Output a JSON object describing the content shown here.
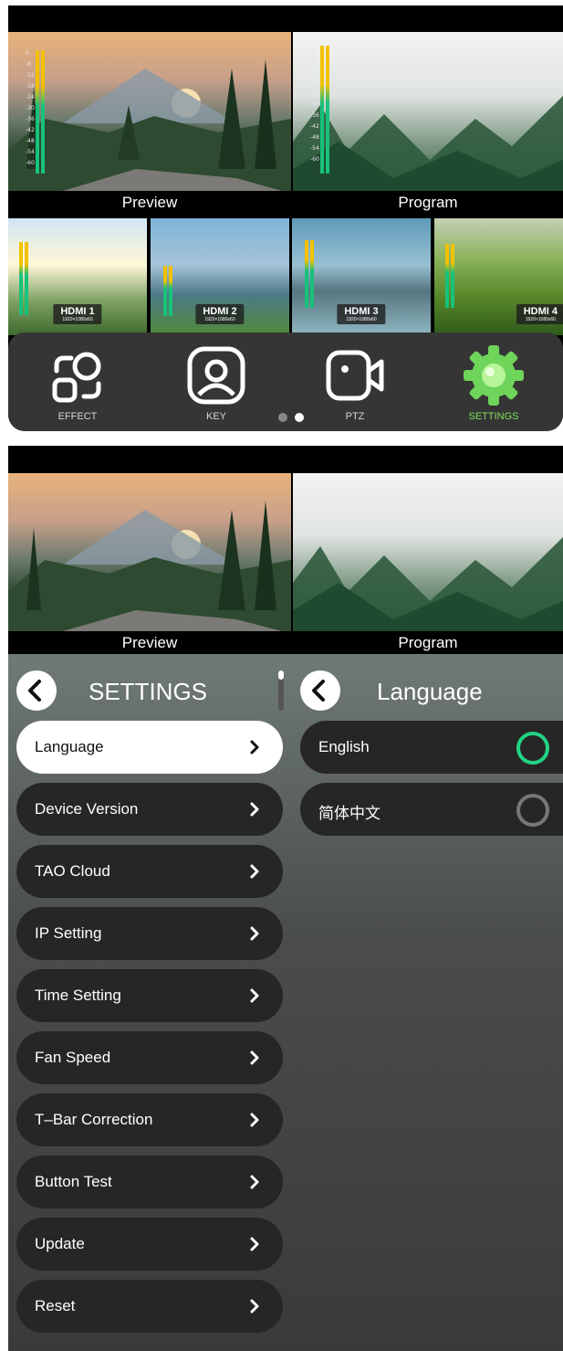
{
  "screen1": {
    "preview_label": "Preview",
    "program_label": "Program",
    "meter_scale": [
      "0",
      "-6",
      "-12",
      "-18",
      "-24",
      "-30",
      "-36",
      "-42",
      "-48",
      "-54",
      "-60"
    ],
    "inputs": [
      {
        "name": "HDMI 1",
        "res": "1920×1080x60"
      },
      {
        "name": "HDMI 2",
        "res": "1920×1080x60"
      },
      {
        "name": "HDMI 3",
        "res": "1920×1080x60"
      },
      {
        "name": "HDMI 4",
        "res": "1920×1080x60"
      }
    ],
    "dock": [
      {
        "label": "EFFECT",
        "icon": "effect-icon"
      },
      {
        "label": "KEY",
        "icon": "key-icon"
      },
      {
        "label": "PTZ",
        "icon": "ptz-camera-icon"
      },
      {
        "label": "SETTINGS",
        "icon": "gear-icon"
      }
    ],
    "page_indicator": {
      "pages": 2,
      "current": 2
    }
  },
  "screen2": {
    "preview_label": "Preview",
    "program_label": "Program",
    "settings_title": "SETTINGS",
    "settings_items": [
      "Language",
      "Device Version",
      "TAO Cloud",
      "IP Setting",
      "Time Setting",
      "Fan Speed",
      "T–Bar Correction",
      "Button Test",
      "Update",
      "Reset"
    ],
    "selected_item": "Language",
    "language_title": "Language",
    "languages": [
      {
        "label": "English",
        "selected": true
      },
      {
        "label": "简体中文",
        "selected": false
      }
    ]
  },
  "colors": {
    "accent_green": "#20d384",
    "settings_green": "#7ee05a",
    "meter_yellow": "#f2c200",
    "meter_green": "#17c27a",
    "item_bg": "#262626"
  }
}
